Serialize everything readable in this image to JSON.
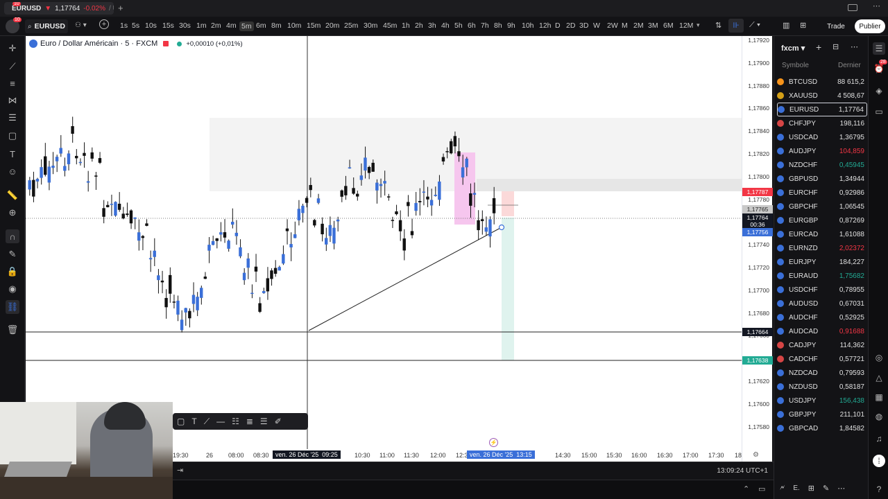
{
  "tab": {
    "notif": "10",
    "symbol": "EURUSD",
    "price": "1,17764",
    "change": "-0.02%",
    "extra": "/ U"
  },
  "toolbar": {
    "symbol": "EURUSD",
    "timeframes": [
      "1s",
      "5s",
      "10s",
      "15s",
      "30s",
      "1m",
      "2m",
      "4m",
      "5m",
      "6m",
      "8m",
      "10m",
      "15m",
      "20m",
      "25m",
      "30m",
      "45m",
      "1h",
      "2h",
      "3h",
      "4h",
      "5h",
      "6h",
      "7h",
      "8h",
      "9h",
      "10h",
      "12h",
      "D",
      "2D",
      "3D",
      "W",
      "2W",
      "M",
      "2M",
      "3M",
      "6M",
      "12M"
    ],
    "selected": "5m",
    "trade_label": "Trade",
    "publish_label": "Publier"
  },
  "chart": {
    "title": "Euro / Dollar Américain · 5 · FXCM",
    "change": "+0,00010 (+0,01%)",
    "price_labels": [
      "1,17920",
      "1,17900",
      "1,17880",
      "1,17860",
      "1,17840",
      "1,17820",
      "1,17800",
      "1,17780",
      "1,17760",
      "1,17740",
      "1,17720",
      "1,17700",
      "1,17680",
      "1,17660",
      "1,17640",
      "1,17620",
      "1,17600",
      "1,17580"
    ],
    "tag_red": "1,17787",
    "tag_gray": "1,17765",
    "tag_dark": "1,17764",
    "tag_dark_sub": "00:36",
    "tag_blue": "1,17756",
    "tag_black": "1,17664",
    "tag_green": "1,17638",
    "time_labels": [
      "19:30",
      "26",
      "08:00",
      "08:30",
      "10:30",
      "11:00",
      "11:30",
      "12:00",
      "12:3",
      "14:30",
      "15:00",
      "15:30",
      "16:00",
      "16:30",
      "17:00",
      "17:30",
      "18"
    ],
    "cursor_time": "ven. 26 Déc '25  09:25",
    "cursor_time2": "ven. 26 Déc '25  13:15",
    "clock": "13:09:24 UTC+1"
  },
  "watchlist": {
    "title": "fxcm",
    "col_symbol": "Symbole",
    "col_last": "Dernier",
    "badge": "28",
    "items": [
      {
        "sym": "BTCUSD",
        "px": "88 615,2",
        "color": "#e0e0e0",
        "dot": "#f7931a"
      },
      {
        "sym": "XAUUSD",
        "px": "4 508,67",
        "color": "#e0e0e0",
        "dot": "#d4a017"
      },
      {
        "sym": "EURUSD",
        "px": "1,17764",
        "color": "#e0e0e0",
        "dot": "#3a6fd8"
      },
      {
        "sym": "CHFJPY",
        "px": "198,116",
        "color": "#e0e0e0",
        "dot": "#d64545"
      },
      {
        "sym": "USDCAD",
        "px": "1,36795",
        "color": "#e0e0e0",
        "dot": "#3a6fd8"
      },
      {
        "sym": "AUDJPY",
        "px": "104,859",
        "color": "#f23645",
        "dot": "#3a6fd8"
      },
      {
        "sym": "NZDCHF",
        "px": "0,45945",
        "color": "#22ab94",
        "dot": "#3a6fd8"
      },
      {
        "sym": "GBPUSD",
        "px": "1,34944",
        "color": "#e0e0e0",
        "dot": "#3a6fd8"
      },
      {
        "sym": "EURCHF",
        "px": "0,92986",
        "color": "#e0e0e0",
        "dot": "#3a6fd8"
      },
      {
        "sym": "GBPCHF",
        "px": "1,06545",
        "color": "#e0e0e0",
        "dot": "#3a6fd8"
      },
      {
        "sym": "EURGBP",
        "px": "0,87269",
        "color": "#e0e0e0",
        "dot": "#3a6fd8"
      },
      {
        "sym": "EURCAD",
        "px": "1,61088",
        "color": "#e0e0e0",
        "dot": "#3a6fd8"
      },
      {
        "sym": "EURNZD",
        "px": "2,02372",
        "color": "#f23645",
        "dot": "#3a6fd8"
      },
      {
        "sym": "EURJPY",
        "px": "184,227",
        "color": "#e0e0e0",
        "dot": "#3a6fd8"
      },
      {
        "sym": "EURAUD",
        "px": "1,75682",
        "color": "#22ab94",
        "dot": "#3a6fd8"
      },
      {
        "sym": "USDCHF",
        "px": "0,78955",
        "color": "#e0e0e0",
        "dot": "#3a6fd8"
      },
      {
        "sym": "AUDUSD",
        "px": "0,67031",
        "color": "#e0e0e0",
        "dot": "#3a6fd8"
      },
      {
        "sym": "AUDCHF",
        "px": "0,52925",
        "color": "#e0e0e0",
        "dot": "#3a6fd8"
      },
      {
        "sym": "AUDCAD",
        "px": "0,91688",
        "color": "#f23645",
        "dot": "#3a6fd8"
      },
      {
        "sym": "CADJPY",
        "px": "114,362",
        "color": "#e0e0e0",
        "dot": "#d64545"
      },
      {
        "sym": "CADCHF",
        "px": "0,57721",
        "color": "#e0e0e0",
        "dot": "#d64545"
      },
      {
        "sym": "NZDCAD",
        "px": "0,79593",
        "color": "#e0e0e0",
        "dot": "#3a6fd8"
      },
      {
        "sym": "NZDUSD",
        "px": "0,58187",
        "color": "#e0e0e0",
        "dot": "#3a6fd8"
      },
      {
        "sym": "USDJPY",
        "px": "156,438",
        "color": "#22ab94",
        "dot": "#3a6fd8"
      },
      {
        "sym": "GBPJPY",
        "px": "211,101",
        "color": "#e0e0e0",
        "dot": "#3a6fd8"
      },
      {
        "sym": "GBPCAD",
        "px": "1,84582",
        "color": "#e0e0e0",
        "dot": "#3a6fd8"
      }
    ]
  },
  "bottom": {
    "e_label": "E."
  }
}
